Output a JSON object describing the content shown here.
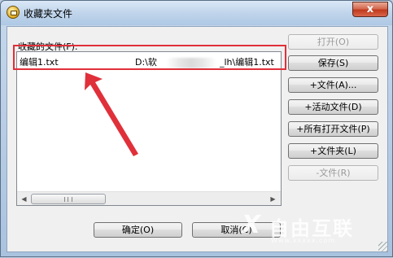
{
  "window": {
    "title": "收藏夹文件",
    "close_label": "x"
  },
  "files": {
    "label": "收藏的文件(F):",
    "items": [
      {
        "name": "编辑1.txt",
        "path_start": "D:\\软",
        "path_end": "_lh\\编辑1.txt"
      }
    ]
  },
  "buttons": {
    "open": "打开(O)",
    "save": "保存(S)",
    "add_file": "+文件(A)...",
    "add_active_file": "+活动文件(D)",
    "add_all_open_files": "+所有打开文件(P)",
    "add_folder": "+文件夹(L)",
    "remove_file": "-文件(R)",
    "ok": "确定(O)",
    "cancel": "取消(C)"
  },
  "watermark": {
    "logo": "X",
    "text": "自由互联",
    "url": "Www.xxxxx.com"
  },
  "colors": {
    "annotation_red": "#e0303a",
    "title_bar": "#c2d6ec",
    "close_red": "#c0391c"
  }
}
